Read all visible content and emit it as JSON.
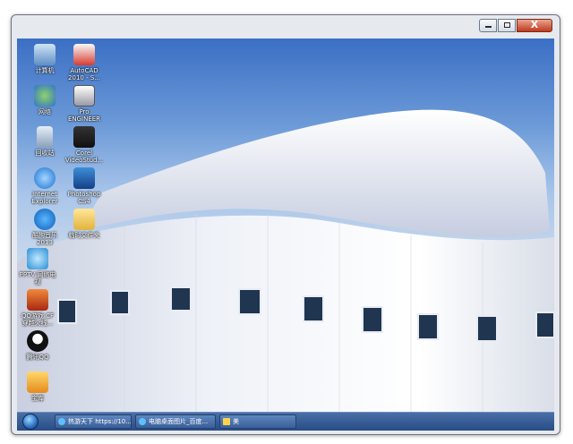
{
  "window": {
    "close_label": "X"
  },
  "desktop_icons": [
    {
      "label": "计算机"
    },
    {
      "label": "AutoCAD\n2010 - S..."
    },
    {
      "label": "网络"
    },
    {
      "label": "Pro\nENGINEER"
    },
    {
      "label": "回收站"
    },
    {
      "label": "Corel\nVideoStud..."
    },
    {
      "label": "Internet\nExplorer"
    },
    {
      "label": "Photoshop\nCS4"
    },
    {
      "label": "酷狗音乐\n2013"
    },
    {
      "label": "临时文件夹"
    },
    {
      "label": "PPTV 网络电\n视"
    },
    {
      "label": "QQ游戏 CF\n穿越火线..."
    },
    {
      "label": "腾讯QQ"
    },
    {
      "label": "宝库"
    }
  ],
  "taskbar": {
    "items": [
      {
        "label": "热游天下 https://10..."
      },
      {
        "label": "电脑桌面图片_百度..."
      },
      {
        "label": "美"
      }
    ]
  },
  "colors": {
    "taskbar": "#284c86",
    "close_button": "#c0391f",
    "sky": "#3b6fc4"
  }
}
